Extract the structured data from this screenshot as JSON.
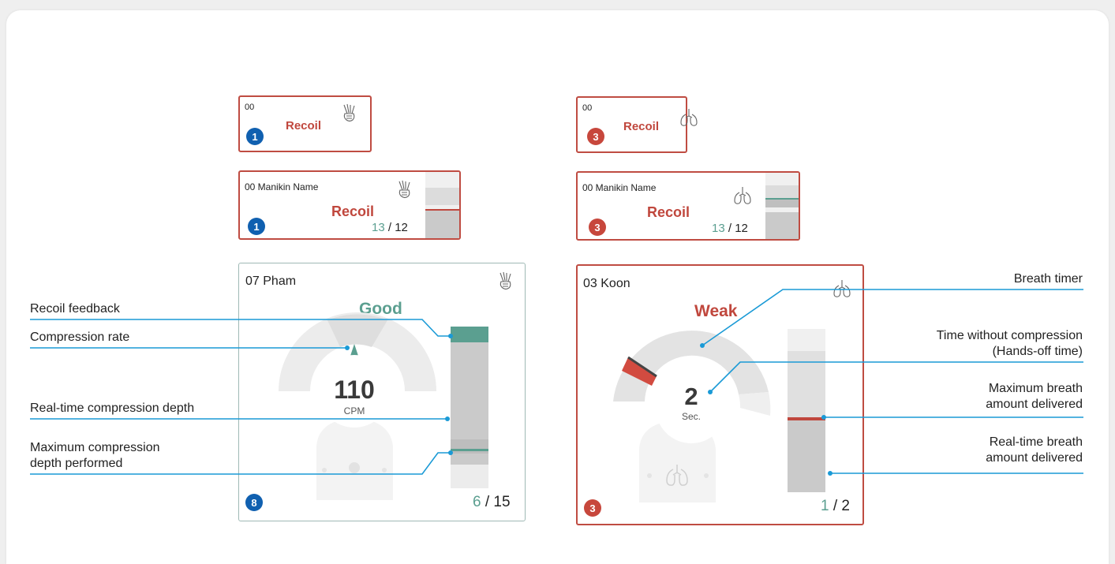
{
  "small_cards": {
    "left": {
      "id": "00",
      "badge": "1",
      "status": "Recoil",
      "icon": "hands-icon"
    },
    "right": {
      "id": "00",
      "badge": "3",
      "status": "Recoil",
      "icon": "lungs-icon"
    }
  },
  "medium_cards": {
    "left": {
      "name": "00 Manikin Name",
      "badge": "1",
      "status": "Recoil",
      "count_done": "13",
      "count_sep": "/ 12",
      "icon": "hands-icon"
    },
    "right": {
      "name": "00 Manikin Name",
      "badge": "3",
      "status": "Recoil",
      "count_done": "13",
      "count_sep": "/ 12",
      "icon": "lungs-icon"
    }
  },
  "compression_card": {
    "name": "07 Pham",
    "status": "Good",
    "rate_value": "110",
    "rate_unit": "CPM",
    "badge": "8",
    "count_done": "6",
    "count_sep": "/ 15",
    "icon": "hands-icon"
  },
  "ventilation_card": {
    "name": "03 Koon",
    "status": "Weak",
    "timer_value": "2",
    "timer_unit": "Sec.",
    "badge": "3",
    "count_done": "1",
    "count_sep": "/ 2",
    "icon": "lungs-icon"
  },
  "callouts_left": {
    "recoil_feedback": "Recoil feedback",
    "compression_rate": "Compression rate",
    "realtime_depth": "Real-time compression depth",
    "max_depth_line1": "Maximum compression",
    "max_depth_line2": "depth performed"
  },
  "callouts_right": {
    "breath_timer": "Breath timer",
    "hands_off_line1": "Time without compression",
    "hands_off_line2": "(Hands-off time)",
    "max_breath_line1": "Maximum breath",
    "max_breath_line2": "amount delivered",
    "realtime_breath_line1": "Real-time breath",
    "realtime_breath_line2": "amount delivered"
  },
  "colors": {
    "accent_red": "#c0473d",
    "accent_teal": "#5b9f90",
    "badge_blue": "#1060b0",
    "callout_blue": "#1a9ad6"
  }
}
